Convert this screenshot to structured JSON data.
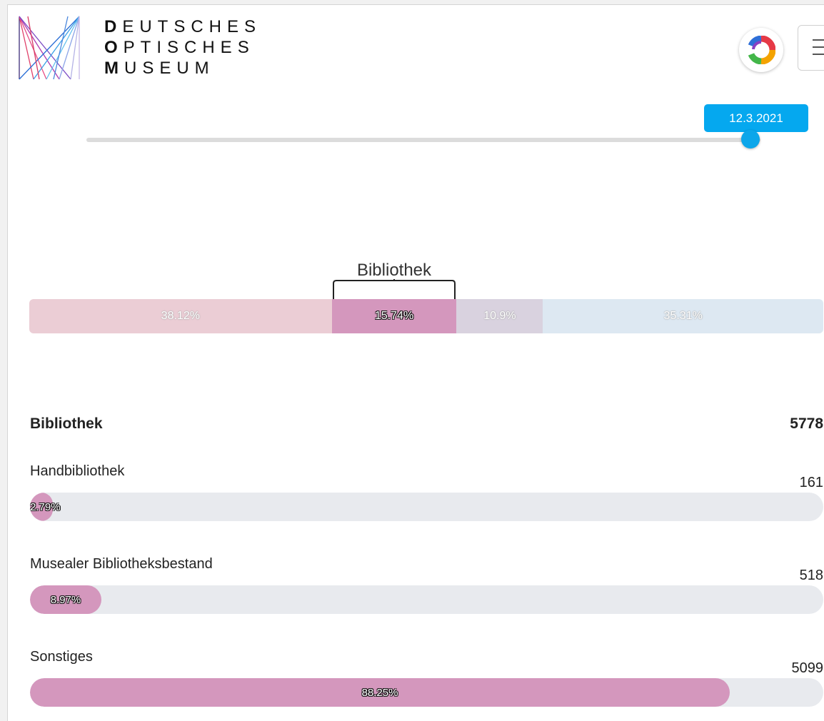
{
  "header": {
    "logo_icon": "dom-line-logo",
    "wordmark": [
      {
        "initial": "D",
        "rest": "EUTSCHES"
      },
      {
        "initial": "O",
        "rest": "PTISCHES"
      },
      {
        "initial": "M",
        "rest": "USEUM"
      }
    ],
    "brand_icon": "color-ring-icon",
    "menu_icon": "hamburger-icon"
  },
  "date_slider": {
    "value_label": "12.3.2021",
    "position_fraction": 0.985
  },
  "overview": {
    "highlight_label": "Bibliothek",
    "segments": [
      {
        "label": "38.12%",
        "value": 38.12,
        "color": "#ebcdd5"
      },
      {
        "label": "15.74%",
        "value": 15.74,
        "color": "#d497bd",
        "active": true
      },
      {
        "label": "10.9%",
        "value": 10.9,
        "color": "#d9d2df"
      },
      {
        "label": "35.31%",
        "value": 35.31,
        "color": "#dde8f2"
      }
    ]
  },
  "category": {
    "name": "Bibliothek",
    "total": "5778",
    "rows": [
      {
        "label": "Handbibliothek",
        "count": "161",
        "percent_label": "2.79%",
        "percent": 2.79
      },
      {
        "label": "Musealer Bibliotheksbestand",
        "count": "518",
        "percent_label": "8.97%",
        "percent": 8.97
      },
      {
        "label": "Sonstiges",
        "count": "5099",
        "percent_label": "88.25%",
        "percent": 88.25
      }
    ]
  },
  "colors": {
    "accent": "#05a8ef",
    "bar_fill": "#d497bd",
    "bar_track": "#e8eaee"
  }
}
